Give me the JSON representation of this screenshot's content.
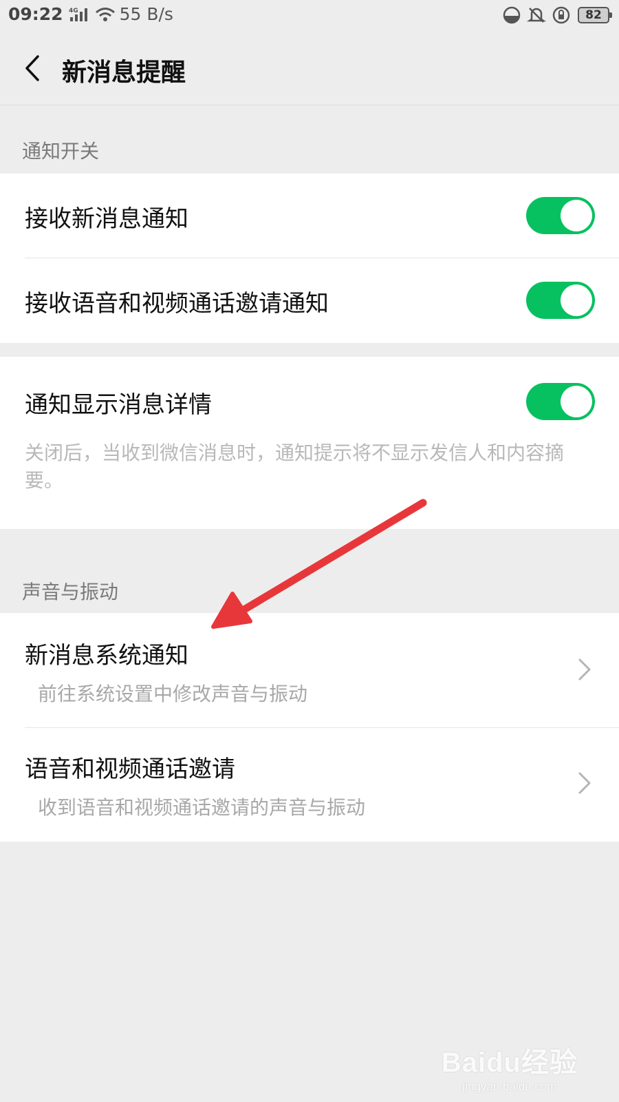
{
  "status_bar": {
    "time": "09:22",
    "network_type": "4G",
    "speed": "55 B/s",
    "battery": "82"
  },
  "header": {
    "title": "新消息提醒"
  },
  "sections": {
    "notification_switch": {
      "header": "通知开关",
      "items": [
        {
          "label": "接收新消息通知",
          "on": true
        },
        {
          "label": "接收语音和视频通话邀请通知",
          "on": true
        }
      ]
    },
    "detail": {
      "label": "通知显示消息详情",
      "on": true,
      "description": "关闭后，当收到微信消息时，通知提示将不显示发信人和内容摘要。"
    },
    "sound_vibration": {
      "header": "声音与振动",
      "items": [
        {
          "label": "新消息系统通知",
          "subtext": "前往系统设置中修改声音与振动"
        },
        {
          "label": "语音和视频通话邀请",
          "subtext": "收到语音和视频通话邀请的声音与振动"
        }
      ]
    }
  },
  "watermark": {
    "logo": "Baidu经验",
    "url": "jingyan.baidu.com"
  },
  "colors": {
    "toggle_on": "#07c160",
    "background": "#ededed",
    "annotation_arrow": "#e8373a"
  },
  "icons": {
    "back": "chevron-left-icon",
    "row_chevron": "chevron-right-icon",
    "annotation": "red-arrow-icon"
  }
}
